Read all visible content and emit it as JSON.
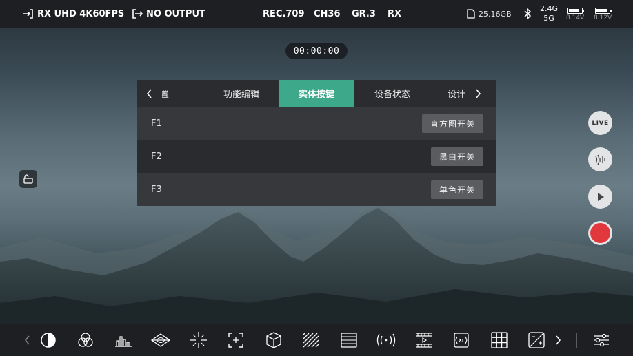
{
  "status_bar": {
    "rx_label": "RX UHD 4K60FPS",
    "output_label": "NO OUTPUT",
    "color_space": "REC.709",
    "channel": "CH36",
    "gr": "GR.3",
    "mode": "RX",
    "storage": "25.16GB",
    "band_top": "2.4G",
    "band_bottom": "5G",
    "battery_1_voltage": "8.14V",
    "battery_2_voltage": "8.12V"
  },
  "timecode": "00:00:00",
  "menu": {
    "tabs": [
      {
        "label": "设置"
      },
      {
        "label": "功能编辑"
      },
      {
        "label": "实体按键",
        "active": true
      },
      {
        "label": "设备状态"
      },
      {
        "label": "设计"
      }
    ],
    "rows": [
      {
        "key": "F1",
        "button": "直方图开关"
      },
      {
        "key": "F2",
        "button": "黑白开关"
      },
      {
        "key": "F3",
        "button": "单色开关"
      }
    ]
  },
  "side_buttons": {
    "live_label": "LIVE"
  },
  "icons": {
    "bottom_tools": [
      "chevron-left-icon",
      "contrast-icon",
      "rgb-circles-icon",
      "histogram-icon",
      "vectorscope-icon",
      "crosshair-icon",
      "focus-frame-icon",
      "lut-cube-icon",
      "zebra-icon",
      "waveform-icon",
      "audio-wave-icon",
      "film-icon",
      "anamorphic-icon",
      "grid-icon",
      "exposure-icon",
      "chevron-right-icon",
      "sliders-icon"
    ]
  },
  "colors": {
    "accent": "#3ea98a",
    "record": "#e0383d"
  }
}
